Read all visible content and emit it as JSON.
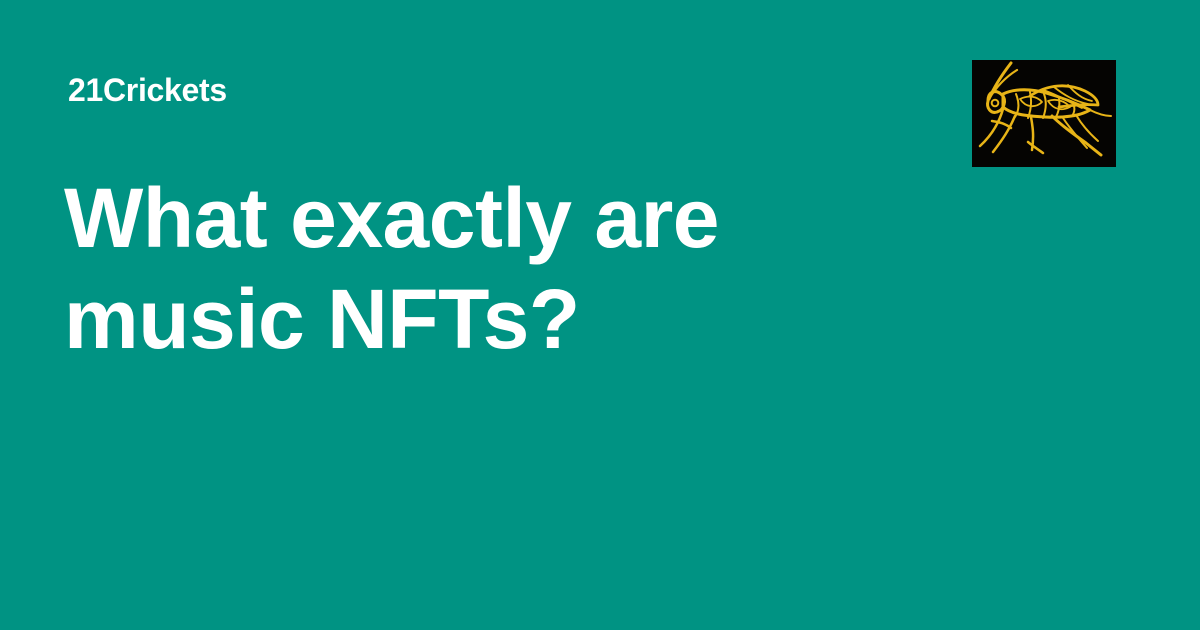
{
  "card": {
    "publication_name": "21Crickets",
    "title": "What exactly are music NFTs?",
    "logo_icon": "cricket-icon"
  },
  "colors": {
    "background": "#009383",
    "text": "#ffffff",
    "logo_background": "#050402",
    "logo_outline": "#e8b417"
  }
}
